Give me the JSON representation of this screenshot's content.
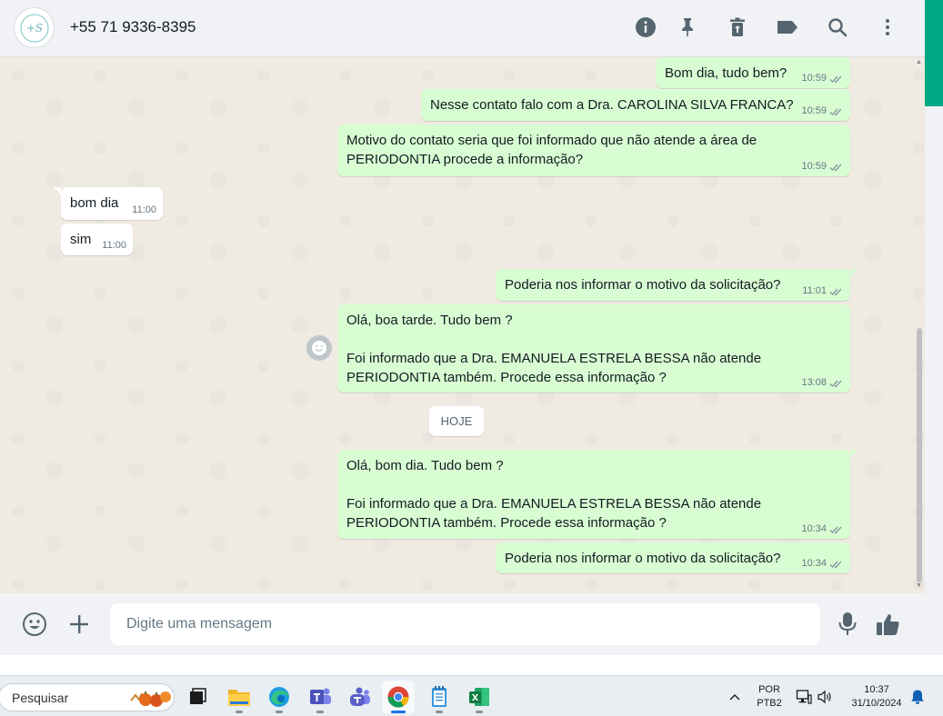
{
  "header": {
    "contact_name": "+55 71 9336-8395",
    "avatar_text": "+S",
    "icons": [
      "info-icon",
      "pin-icon",
      "delete-icon",
      "label-icon",
      "search-icon",
      "menu-icon"
    ]
  },
  "messages": [
    {
      "direction": "out",
      "text": "Bom dia, tudo bem?",
      "time": "10:59",
      "status": "read"
    },
    {
      "direction": "out",
      "text": "Nesse contato falo com a Dra. CAROLINA SILVA FRANCA?",
      "time": "10:59",
      "status": "read"
    },
    {
      "direction": "out",
      "text": "Motivo do contato seria que foi informado que não atende a área de\nPERIODONTIA procede a informação?",
      "time": "10:59",
      "status": "read"
    },
    {
      "direction": "in",
      "text": "bom dia",
      "time": "11:00"
    },
    {
      "direction": "in",
      "text": "sim",
      "time": "11:00"
    },
    {
      "direction": "out",
      "text": "Poderia nos informar o motivo da solicitação?",
      "time": "11:01",
      "status": "read"
    },
    {
      "direction": "out",
      "text": "Olá, boa tarde. Tudo bem ?\n\nFoi informado que a Dra. EMANUELA ESTRELA BESSA não atende\nPERIODONTIA também. Procede essa informação ?",
      "time": "13:08",
      "status": "read"
    },
    {
      "direction": "out",
      "text": "Olá, bom dia. Tudo bem ?\n\nFoi informado que a Dra. EMANUELA ESTRELA BESSA não atende\nPERIODONTIA também. Procede essa informação ?",
      "time": "10:34",
      "status": "read"
    },
    {
      "direction": "out",
      "text": "Poderia nos informar o motivo da solicitação?",
      "time": "10:34",
      "status": "read"
    }
  ],
  "date_divider": "HOJE",
  "composer": {
    "placeholder": "Digite uma mensagem",
    "icons": [
      "emoji-icon",
      "plus-icon",
      "microphone-icon",
      "thumbs-up-icon"
    ]
  },
  "taskbar": {
    "search_label": "Pesquisar",
    "apps": [
      "task-view",
      "file-explorer",
      "edge",
      "teams-classic",
      "teams",
      "chrome",
      "notepad",
      "excel"
    ],
    "active_app": "chrome",
    "language": "POR",
    "layout": "PTB2",
    "time": "10:37",
    "date": "31/10/2024"
  },
  "colors": {
    "outgoing_bubble": "#d9fdd3",
    "incoming_bubble": "#ffffff",
    "chat_background": "#efeae2",
    "header_background": "#f0f2f5",
    "read_ticks": "#8696a0",
    "accent": "#00a884"
  }
}
